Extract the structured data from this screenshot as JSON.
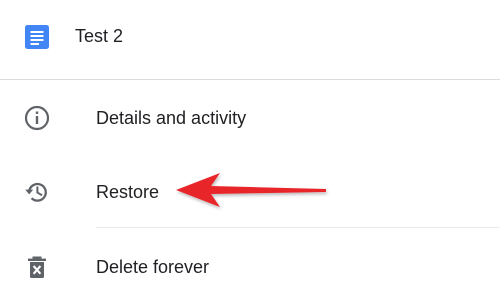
{
  "header": {
    "doc_icon": "google-docs-icon",
    "title": "Test 2"
  },
  "menu": {
    "items": [
      {
        "label": "Details and activity",
        "icon": "info-icon"
      },
      {
        "label": "Restore",
        "icon": "history-icon"
      },
      {
        "label": "Delete forever",
        "icon": "trash-icon"
      }
    ]
  },
  "annotation": {
    "arrow_color": "#e8262c",
    "points_to": "Restore"
  },
  "colors": {
    "docs_blue": "#4285f4",
    "icon_gray": "#5f6368",
    "divider": "#dadce0"
  }
}
